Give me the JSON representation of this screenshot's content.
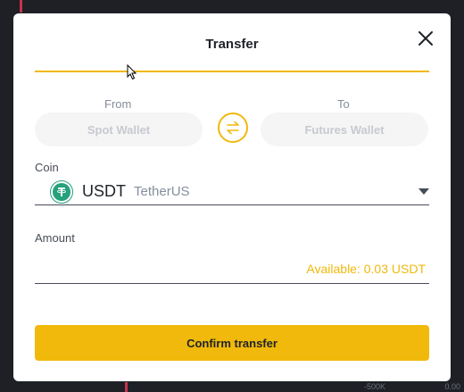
{
  "modal": {
    "title": "Transfer",
    "from_label": "From",
    "to_label": "To",
    "from_wallet": "Spot Wallet",
    "to_wallet": "Futures Wallet",
    "coin_label": "Coin",
    "coin": {
      "symbol": "USDT",
      "name": "TetherUS",
      "icon": "tether-icon"
    },
    "amount_label": "Amount",
    "amount_value": "",
    "available": "Available: 0.03 USDT",
    "confirm_label": "Confirm transfer"
  },
  "background": {
    "axis_labels": [
      "-500K",
      "0.00"
    ]
  },
  "colors": {
    "accent": "#f0b90b",
    "tether": "#26a17b",
    "overlay": "#1e2026"
  }
}
